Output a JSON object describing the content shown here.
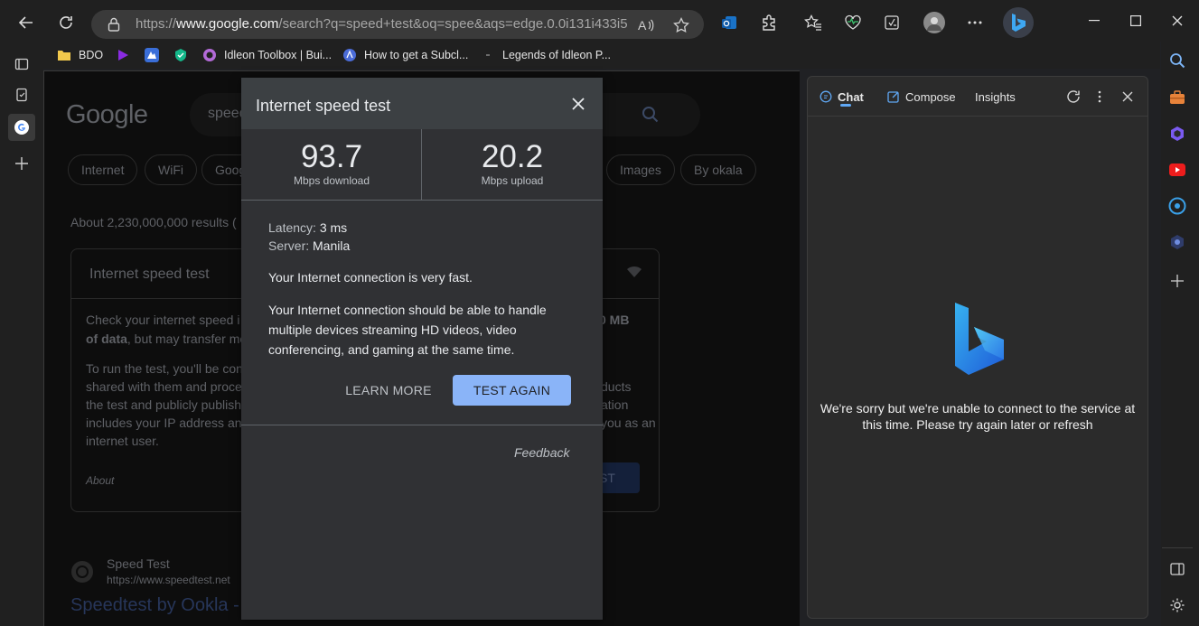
{
  "browser": {
    "url_prefix": "https://",
    "url_domain": "www.google.com",
    "url_rest": "/search?q=speed+test&oq=spee&aqs=edge.0.0i131i433i512j..."
  },
  "bookmarks": [
    {
      "label": "BDO",
      "icon": "folder-icon",
      "color": "#f2c94c"
    },
    {
      "label": "",
      "icon": "play-icon",
      "color": "#8a2be2"
    },
    {
      "label": "",
      "icon": "app-icon",
      "color": "#3a6ed8"
    },
    {
      "label": "",
      "icon": "shield-icon",
      "color": "#14b88a"
    },
    {
      "label": "Idleon Toolbox | Bui...",
      "icon": "idleon-icon",
      "color": "#b36ad8"
    },
    {
      "label": "How to get a Subcl...",
      "icon": "globe-icon",
      "color": "#4b6cd8"
    },
    {
      "label": "Legends of Idleon P...",
      "icon": "page-icon",
      "color": "#9a9a9a"
    }
  ],
  "google_page": {
    "logo": "Google",
    "query": "speed",
    "chips": [
      "Internet",
      "WiFi",
      "Goog",
      "Images",
      "By okala"
    ],
    "result_stats": "About 2,230,000,000 results (",
    "card_title": "Internet speed test",
    "card_p1a": "Check your internet speed i",
    "card_p1b": "of data",
    "card_p1c": ", but may transfer mo",
    "card_p1_right": "0 MB",
    "card_p2": [
      "To run the test, you'll be con",
      "shared with them and proce",
      "the test and publicly publish",
      "includes your IP address an",
      "internet user."
    ],
    "card_p2_right": [
      "ducts",
      "ation",
      "you as an"
    ],
    "about": "About",
    "run_btn": "ST",
    "result_site": "Speed Test",
    "result_url": "https://www.speedtest.net",
    "result_link": "Speedtest by Ookla -"
  },
  "speedtest": {
    "title": "Internet speed test",
    "download_value": "93.7",
    "download_unit": "Mbps download",
    "upload_value": "20.2",
    "upload_unit": "Mbps upload",
    "latency_label": "Latency: ",
    "latency_value": "3 ms",
    "server_label": "Server: ",
    "server_value": "Manila",
    "summary": "Your Internet connection is very fast.",
    "detail": "Your Internet connection should be able to handle multiple devices streaming HD videos, video conferencing, and gaming at the same time.",
    "learn_more": "LEARN MORE",
    "test_again": "TEST AGAIN",
    "feedback": "Feedback",
    "accent": "#8ab4f8"
  },
  "bing_pane": {
    "tabs": [
      "Chat",
      "Compose",
      "Insights"
    ],
    "active_tab": "Chat",
    "error_message": "We're sorry but we're unable to connect to the service at this time. Please try again later or refresh"
  }
}
